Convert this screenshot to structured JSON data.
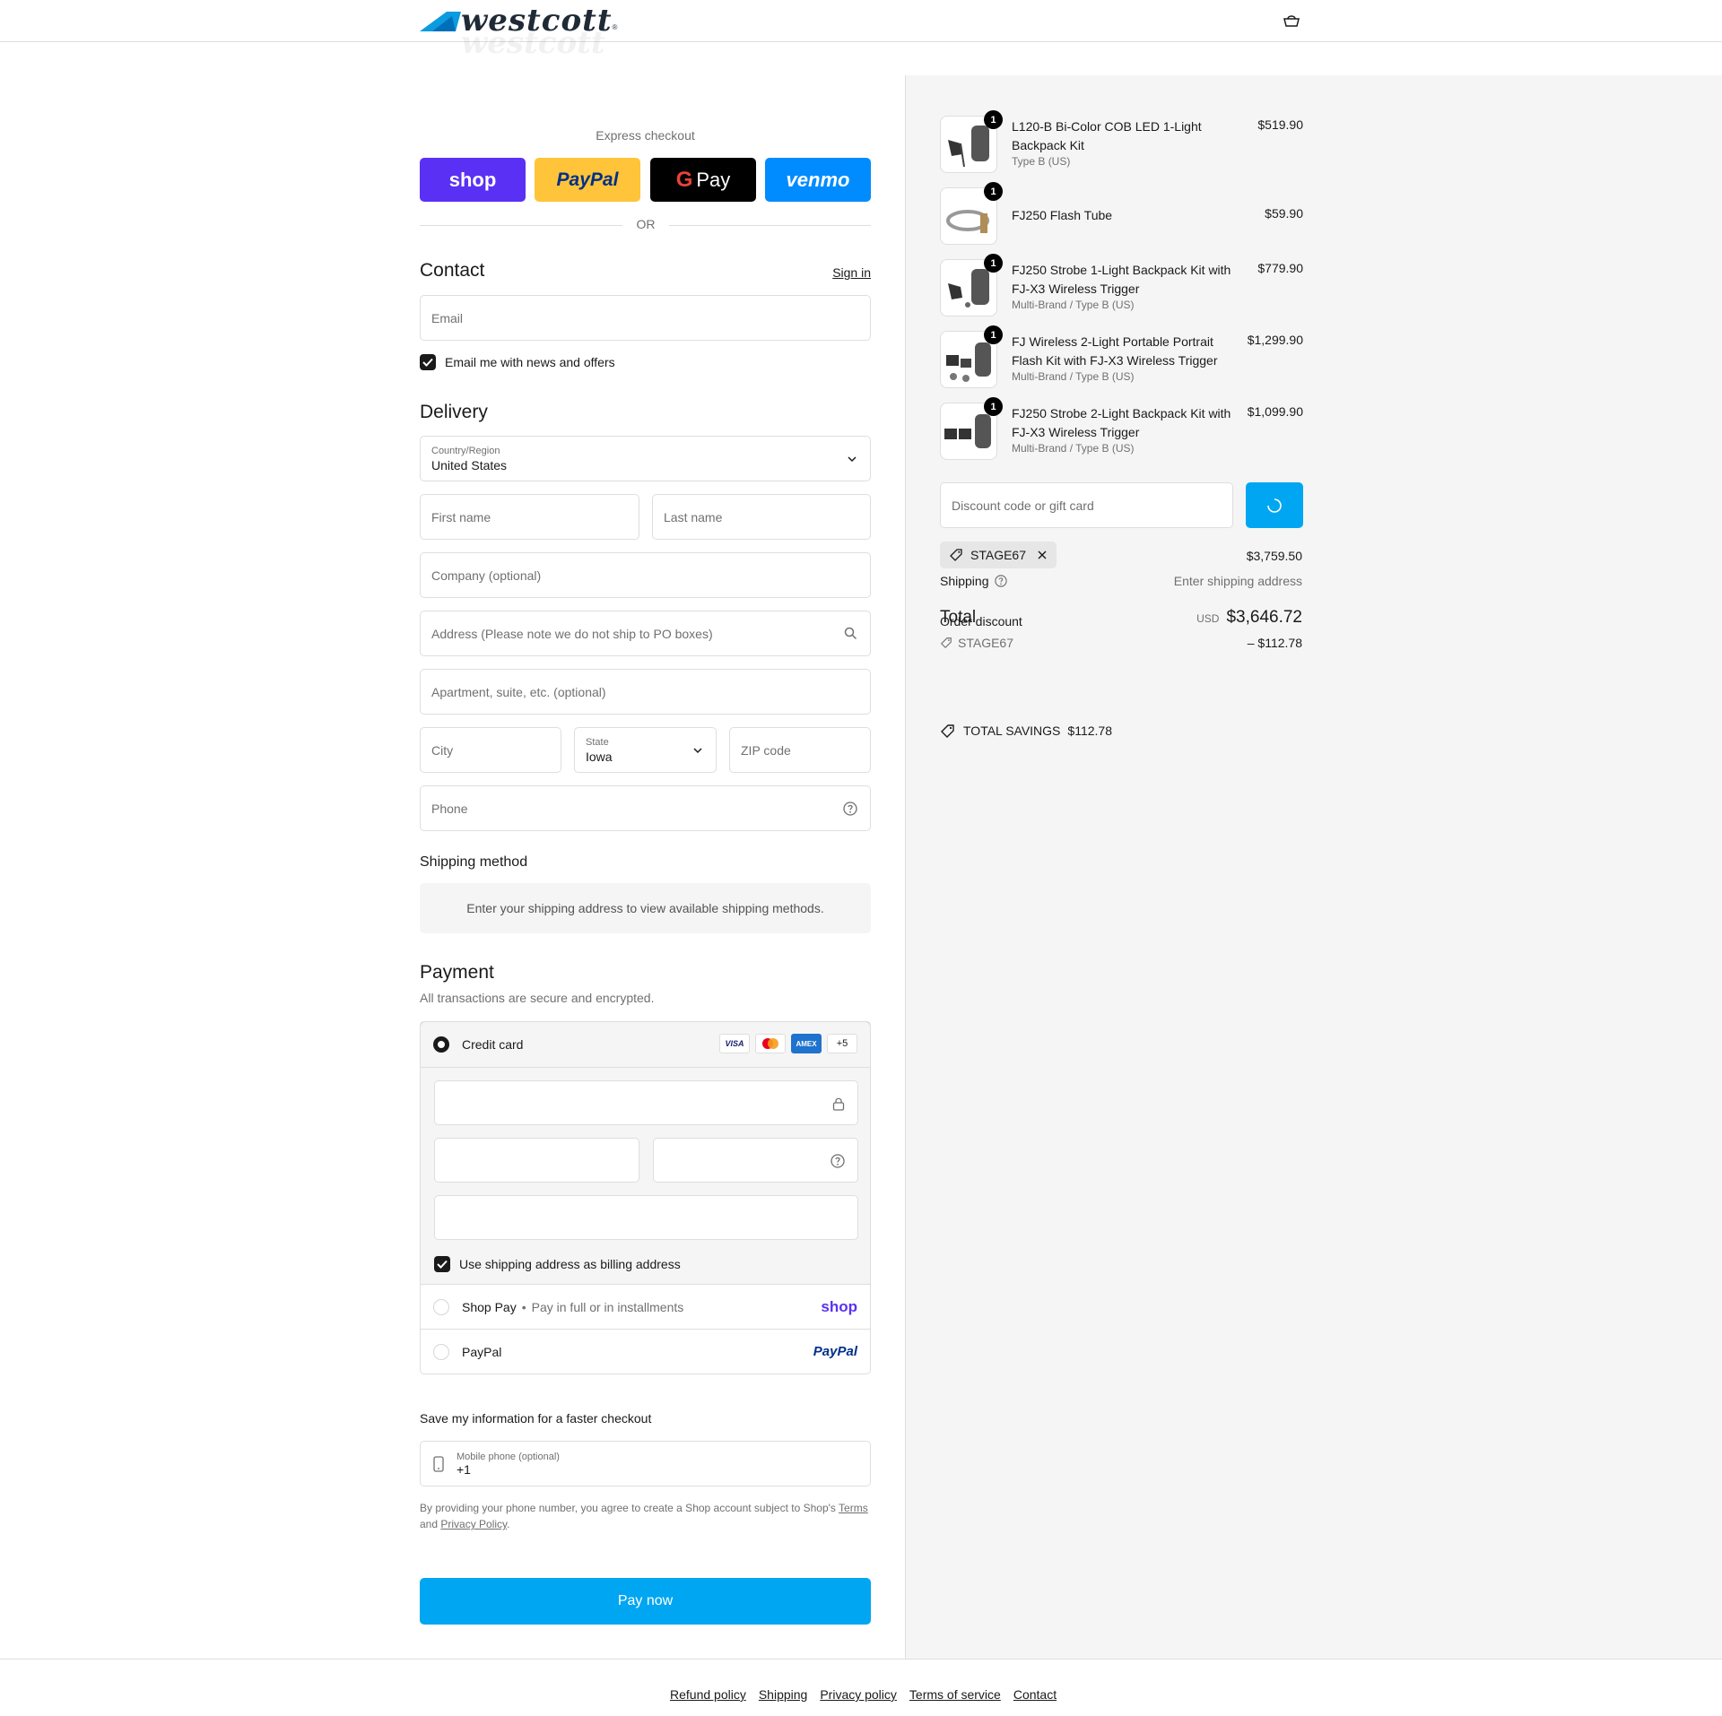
{
  "brand": {
    "name": "westcott",
    "tm": "®"
  },
  "express": {
    "title": "Express checkout",
    "buttons": [
      {
        "label": "shop",
        "bg": "#5a31f4",
        "fg": "#ffffff"
      },
      {
        "label": "PayPal",
        "bg": "#ffc439",
        "fg": "#003087"
      },
      {
        "label": "Pay",
        "bg": "#000000",
        "fg": "#ffffff"
      },
      {
        "label": "venmo",
        "bg": "#008cff",
        "fg": "#ffffff"
      }
    ],
    "or": "OR"
  },
  "contact": {
    "heading": "Contact",
    "signin": "Sign in",
    "email_placeholder": "Email",
    "newsletter_label": "Email me with news and offers",
    "newsletter_checked": true
  },
  "delivery": {
    "heading": "Delivery",
    "country_label": "Country/Region",
    "country_value": "United States",
    "first_name": "First name",
    "last_name": "Last name",
    "company": "Company (optional)",
    "address": "Address (Please note we do not ship to PO boxes)",
    "apartment": "Apartment, suite, etc. (optional)",
    "city": "City",
    "state_label": "State",
    "state_value": "Iowa",
    "zip": "ZIP code",
    "phone": "Phone"
  },
  "shipping_method": {
    "heading": "Shipping method",
    "notice": "Enter your shipping address to view available shipping methods."
  },
  "payment": {
    "heading": "Payment",
    "subtitle": "All transactions are secure and encrypted.",
    "credit_card_label": "Credit card",
    "cards": [
      "VISA",
      "MC",
      "AMEX",
      "+5"
    ],
    "billing_label": "Use shipping address as billing address",
    "shop_pay_label": "Shop Pay",
    "shop_pay_sub": "Pay in full or in installments",
    "shop_pay_logo": "shop",
    "paypal_label": "PayPal",
    "paypal_logo": "PayPal"
  },
  "save_info": {
    "heading": "Save my information for a faster checkout",
    "mobile_label": "Mobile phone (optional)",
    "mobile_value": "+1",
    "legal_pre": "By providing your phone number, you agree to create a Shop account subject to Shop's ",
    "legal_terms": "Terms",
    "legal_and": "and ",
    "legal_privacy": "Privacy Policy",
    "legal_end": "."
  },
  "pay_now": "Pay now",
  "cart": {
    "items": [
      {
        "name": "L120-B Bi-Color COB LED 1-Light Backpack Kit",
        "variant": "Type B (US)",
        "price": "$519.90",
        "qty": "1"
      },
      {
        "name": "FJ250 Flash Tube",
        "variant": "",
        "price": "$59.90",
        "qty": "1"
      },
      {
        "name": "FJ250 Strobe 1-Light Backpack Kit with FJ-X3 Wireless Trigger",
        "variant": "Multi-Brand / Type B (US)",
        "price": "$779.90",
        "qty": "1"
      },
      {
        "name": "FJ Wireless 2-Light Portable Portrait Flash Kit with FJ-X3 Wireless Trigger",
        "variant": "Multi-Brand / Type B (US)",
        "price": "$1,299.90",
        "qty": "1"
      },
      {
        "name": "FJ250 Strobe 2-Light Backpack Kit with FJ-X3 Wireless Trigger",
        "variant": "Multi-Brand / Type B (US)",
        "price": "$1,099.90",
        "qty": "1"
      }
    ],
    "discount_placeholder": "Discount code or gift card",
    "applied_code": "STAGE67",
    "subtotal": "$3,759.50",
    "shipping_label": "Shipping",
    "shipping_value": "Enter shipping address",
    "total_label": "Total",
    "order_discount_label": "Order discount",
    "discount_code": "STAGE67",
    "discount_amount": "– $112.78",
    "currency": "USD",
    "total_value": "$3,646.72",
    "savings_label": "TOTAL SAVINGS",
    "savings_value": "$112.78"
  },
  "footer": [
    "Refund policy",
    "Shipping",
    "Privacy policy",
    "Terms of service",
    "Contact"
  ],
  "colors": {
    "accent": "#00a6f1",
    "border": "#dedede",
    "panel": "#f5f5f5"
  }
}
